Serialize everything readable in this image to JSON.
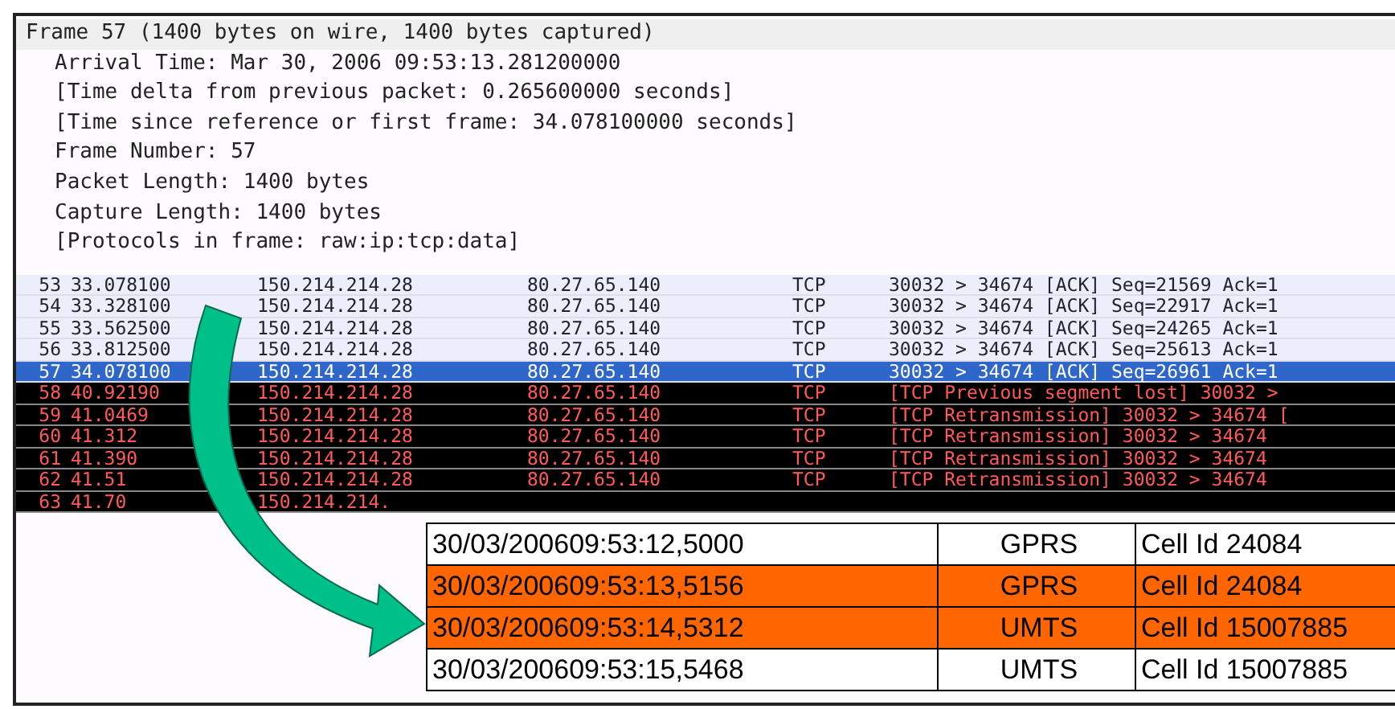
{
  "details": {
    "header": "Frame 57 (1400 bytes on wire, 1400 bytes captured)",
    "lines": [
      "Arrival Time: Mar 30, 2006 09:53:13.281200000",
      "[Time delta from previous packet: 0.265600000 seconds]",
      "[Time since reference or first frame: 34.078100000 seconds]",
      "Frame Number: 57",
      "Packet Length: 1400 bytes",
      "Capture Length: 1400 bytes",
      "[Protocols in frame: raw:ip:tcp:data]"
    ]
  },
  "packets": [
    {
      "kind": "normal",
      "selected": false,
      "no": "53",
      "time": "33.078100",
      "source": "150.214.214.28",
      "destination": "80.27.65.140",
      "protocol": "TCP",
      "info": "30032 > 34674 [ACK] Seq=21569 Ack=1"
    },
    {
      "kind": "normal",
      "selected": false,
      "no": "54",
      "time": "33.328100",
      "source": "150.214.214.28",
      "destination": "80.27.65.140",
      "protocol": "TCP",
      "info": "30032 > 34674 [ACK] Seq=22917 Ack=1"
    },
    {
      "kind": "normal",
      "selected": false,
      "no": "55",
      "time": "33.562500",
      "source": "150.214.214.28",
      "destination": "80.27.65.140",
      "protocol": "TCP",
      "info": "30032 > 34674 [ACK] Seq=24265 Ack=1"
    },
    {
      "kind": "normal",
      "selected": false,
      "no": "56",
      "time": "33.812500",
      "source": "150.214.214.28",
      "destination": "80.27.65.140",
      "protocol": "TCP",
      "info": "30032 > 34674 [ACK] Seq=25613 Ack=1"
    },
    {
      "kind": "normal",
      "selected": true,
      "no": "57",
      "time": "34.078100",
      "source": "150.214.214.28",
      "destination": "80.27.65.140",
      "protocol": "TCP",
      "info": "30032 > 34674 [ACK] Seq=26961 Ack=1"
    },
    {
      "kind": "error",
      "selected": false,
      "no": "58",
      "time": "40.92190",
      "source": "150.214.214.28",
      "destination": "80.27.65.140",
      "protocol": "TCP",
      "info": "[TCP Previous segment lost] 30032 >"
    },
    {
      "kind": "error",
      "selected": false,
      "no": "59",
      "time": "41.0469",
      "source": "150.214.214.28",
      "destination": "80.27.65.140",
      "protocol": "TCP",
      "info": "[TCP Retransmission] 30032 > 34674 ["
    },
    {
      "kind": "error",
      "selected": false,
      "no": "60",
      "time": "41.312",
      "source": "150.214.214.28",
      "destination": "80.27.65.140",
      "protocol": "TCP",
      "info": "[TCP Retransmission] 30032 > 34674"
    },
    {
      "kind": "error",
      "selected": false,
      "no": "61",
      "time": "41.390",
      "source": "150.214.214.28",
      "destination": "80.27.65.140",
      "protocol": "TCP",
      "info": "[TCP Retransmission] 30032 > 34674"
    },
    {
      "kind": "error",
      "selected": false,
      "no": "62",
      "time": "41.51",
      "source": "150.214.214.28",
      "destination": "80.27.65.140",
      "protocol": "TCP",
      "info": "[TCP Retransmission] 30032 > 34674"
    },
    {
      "kind": "error",
      "selected": false,
      "no": "63",
      "time": "41.70",
      "source": "150.214.214."
    }
  ],
  "cell_table": [
    {
      "highlighted": false,
      "timestamp": "30/03/200609:53:12,5000",
      "network": "GPRS",
      "cell": "Cell Id 24084"
    },
    {
      "highlighted": true,
      "timestamp": "30/03/200609:53:13,5156",
      "network": "GPRS",
      "cell": "Cell Id 24084"
    },
    {
      "highlighted": true,
      "timestamp": "30/03/200609:53:14,5312",
      "network": "UMTS",
      "cell": "Cell Id 15007885"
    },
    {
      "highlighted": false,
      "timestamp": "30/03/200609:53:15,5468",
      "network": "UMTS",
      "cell": "Cell Id 15007885"
    }
  ]
}
